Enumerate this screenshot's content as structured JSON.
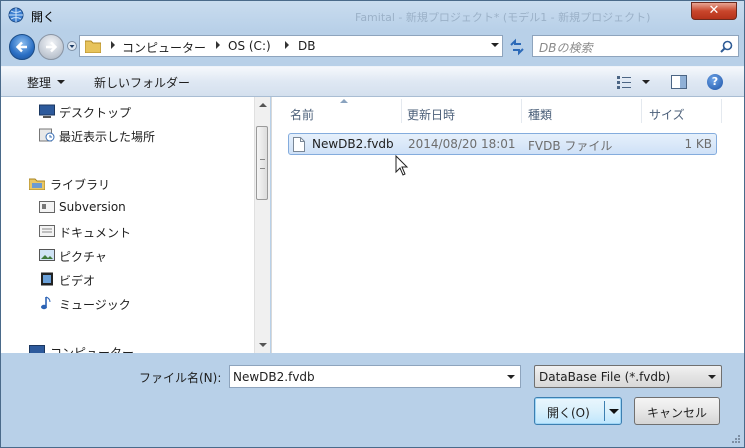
{
  "window": {
    "title": "開く",
    "background_title_ghost": "Famital - 新規プロジェクト* (モデル1 - 新規プロジェクト)"
  },
  "nav": {
    "breadcrumbs": [
      "コンピューター",
      "OS (C:)",
      "DB"
    ],
    "search_placeholder": "DBの検索"
  },
  "toolbar": {
    "organize_label": "整理",
    "new_folder_label": "新しいフォルダー"
  },
  "sidebar": {
    "items": [
      {
        "label": "デスクトップ",
        "icon": "desktop-icon"
      },
      {
        "label": "最近表示した場所",
        "icon": "recent-places-icon"
      },
      {
        "label": "ライブラリ",
        "icon": "library-icon"
      },
      {
        "label": "Subversion",
        "icon": "library-folder-icon"
      },
      {
        "label": "ドキュメント",
        "icon": "documents-icon"
      },
      {
        "label": "ピクチャ",
        "icon": "pictures-icon"
      },
      {
        "label": "ビデオ",
        "icon": "videos-icon"
      },
      {
        "label": "ミュージック",
        "icon": "music-icon"
      },
      {
        "label": "コンピューター",
        "icon": "computer-icon"
      }
    ]
  },
  "files": {
    "columns": [
      "名前",
      "更新日時",
      "種類",
      "サイズ"
    ],
    "rows": [
      {
        "name": "NewDB2.fvdb",
        "modified": "2014/08/20 18:01",
        "type": "FVDB ファイル",
        "size": "1 KB"
      }
    ]
  },
  "footer": {
    "filename_label": "ファイル名(N):",
    "filename_value": "NewDB2.fvdb",
    "filetype_value": "DataBase File (*.fvdb)",
    "open_label": "開く(O)",
    "cancel_label": "キャンセル"
  },
  "colors": {
    "chrome": "#b8d0e8",
    "selection": "#cfe1f7",
    "close_red": "#c9462c",
    "default_button": "#3c7fb1"
  }
}
